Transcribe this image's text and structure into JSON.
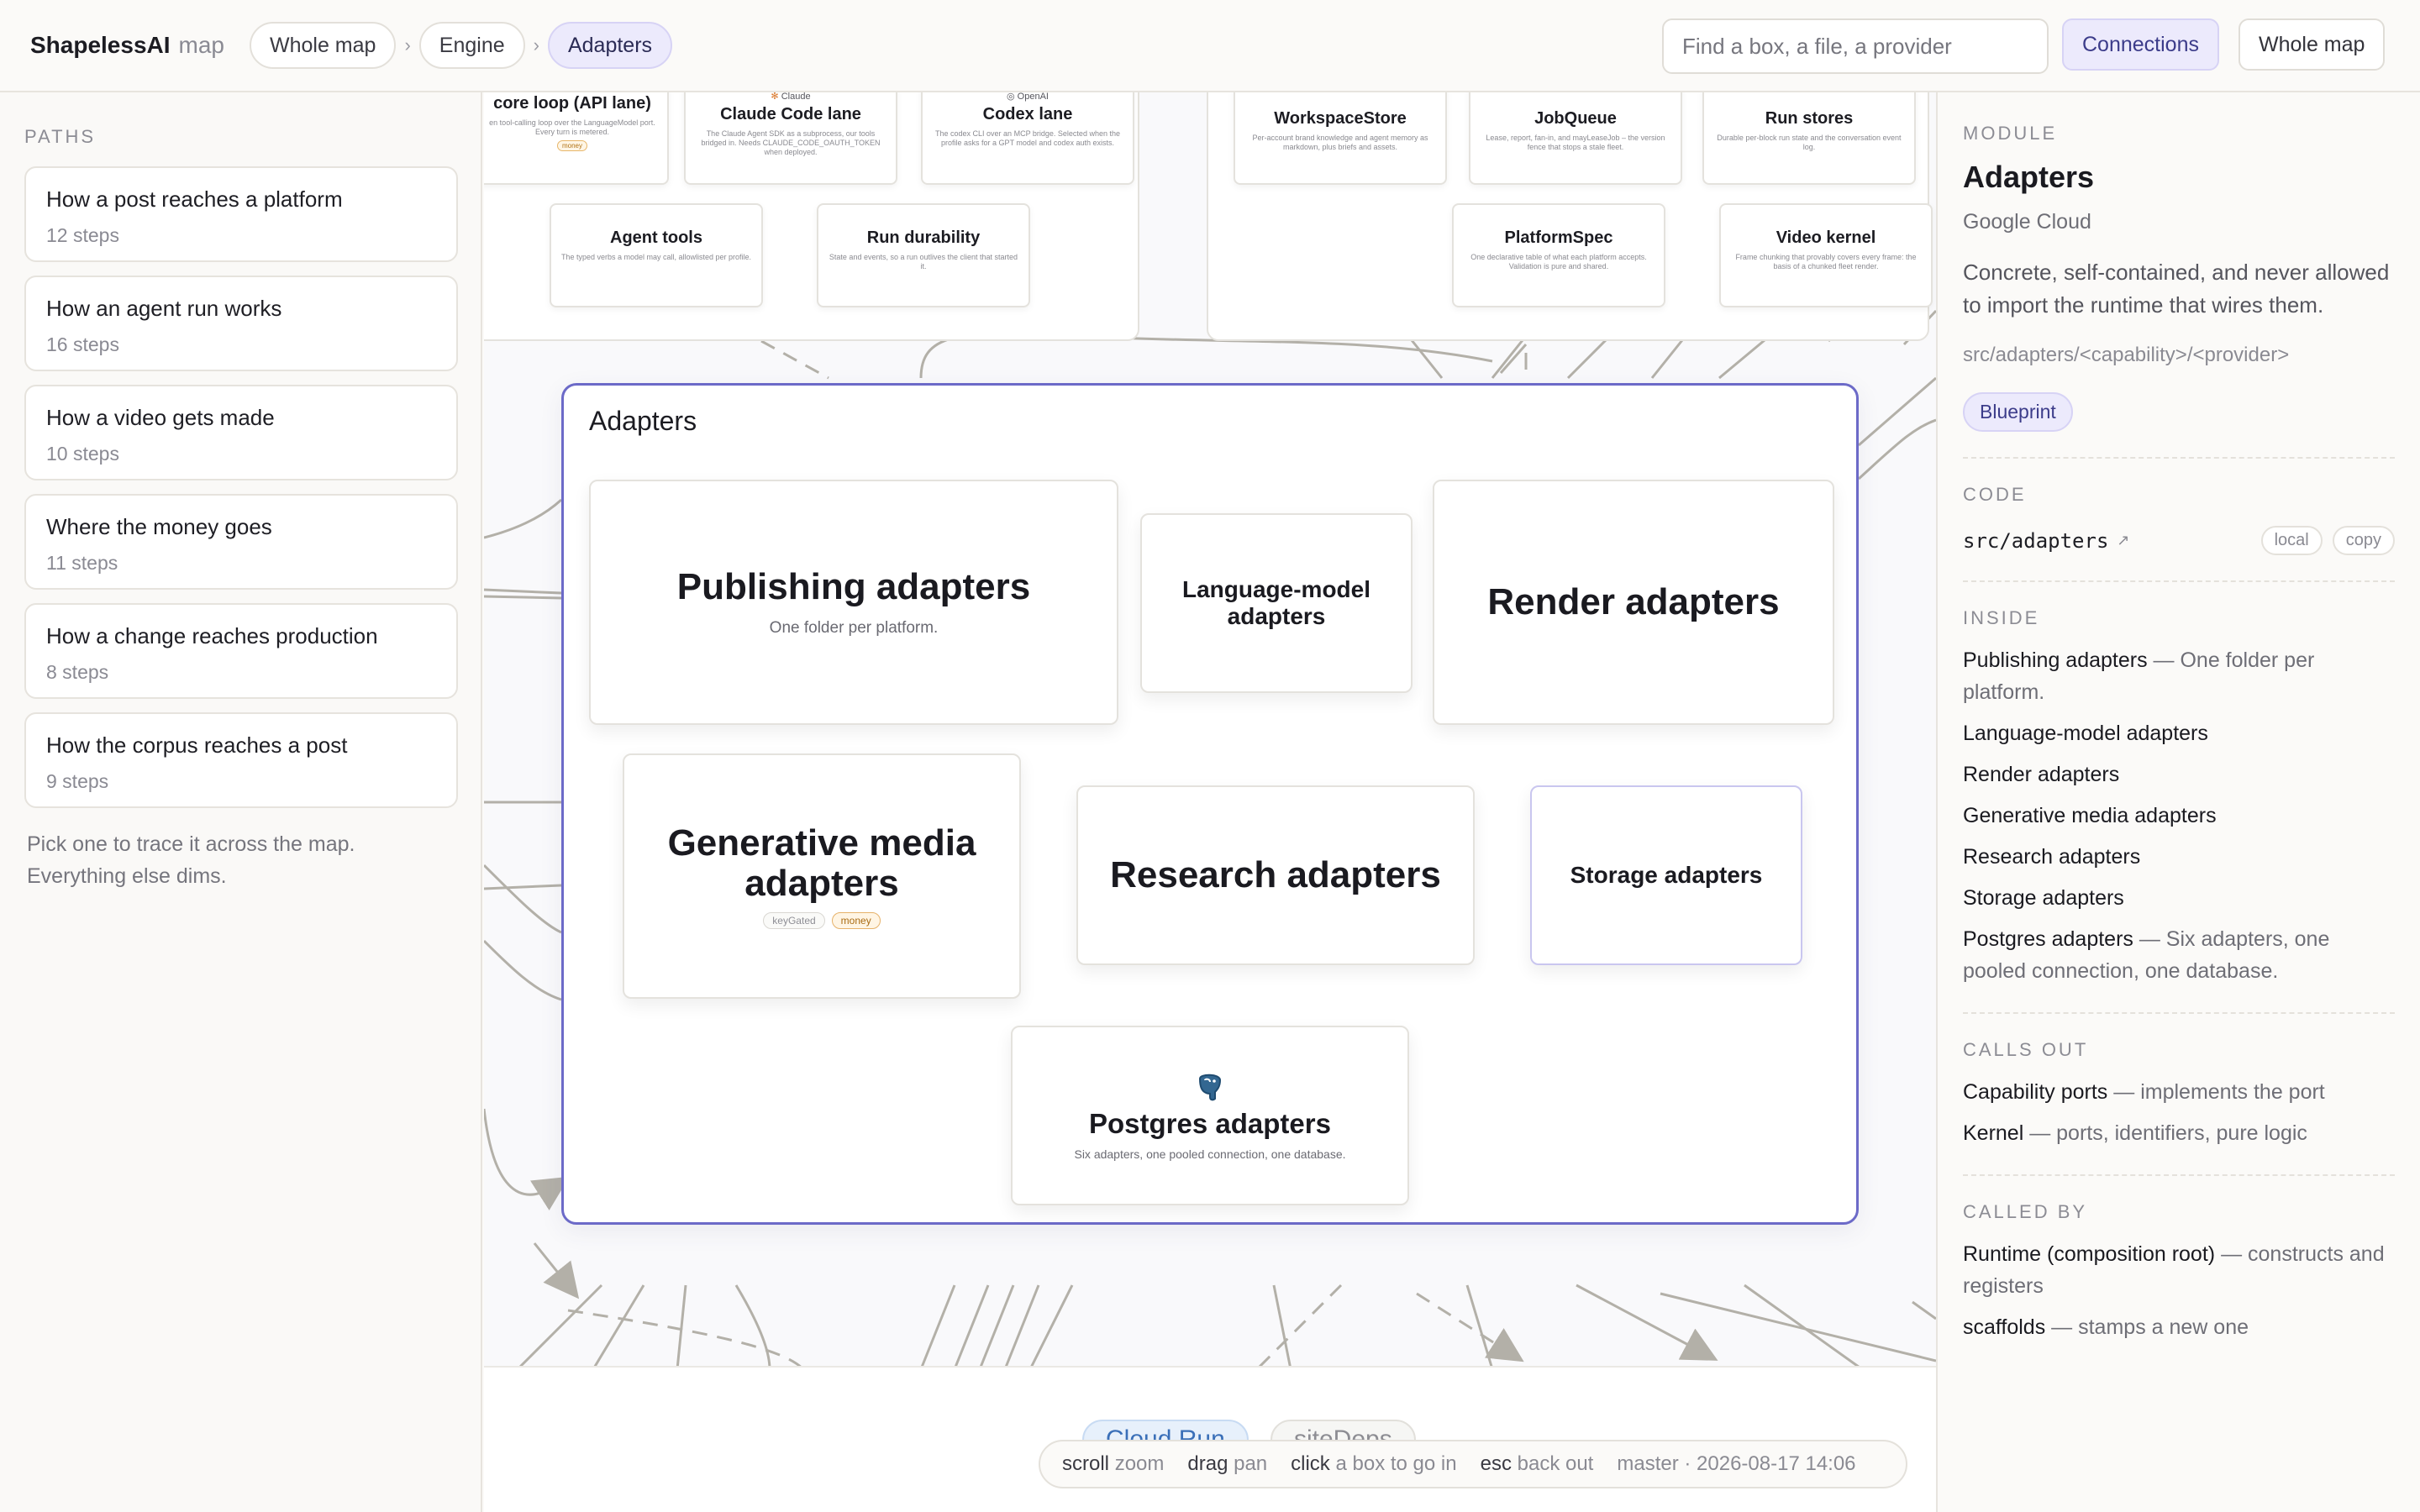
{
  "brand": {
    "name": "ShapelessAI",
    "sub": "map"
  },
  "breadcrumbs": [
    "Whole map",
    "Engine",
    "Adapters"
  ],
  "breadcrumb_sep": "›",
  "search": {
    "placeholder": "Find a box, a file, a provider",
    "value": ""
  },
  "top_buttons": {
    "connections": "Connections",
    "whole_map": "Whole map"
  },
  "paths": {
    "heading": "PATHS",
    "items": [
      {
        "title": "How a post reaches a platform",
        "steps": "12 steps"
      },
      {
        "title": "How an agent run works",
        "steps": "16 steps"
      },
      {
        "title": "How a video gets made",
        "steps": "10 steps"
      },
      {
        "title": "Where the money goes",
        "steps": "11 steps"
      },
      {
        "title": "How a change reaches production",
        "steps": "8 steps"
      },
      {
        "title": "How the corpus reaches a post",
        "steps": "9 steps"
      }
    ],
    "hint": "Pick one to trace it across the map. Everything else dims."
  },
  "canvas": {
    "top_cards": [
      {
        "title": "core loop (API lane)",
        "desc": "en tool-calling loop over the LanguageModel port. Every turn is metered.",
        "tag": "money"
      },
      {
        "brand": "Claude",
        "title": "Claude Code lane",
        "desc": "The Claude Agent SDK as a subprocess, our tools bridged in. Needs CLAUDE_CODE_OAUTH_TOKEN when deployed."
      },
      {
        "brand": "OpenAI",
        "title": "Codex lane",
        "desc": "The codex CLI over an MCP bridge. Selected when the profile asks for a GPT model and codex auth exists."
      },
      {
        "title": "Agent tools",
        "desc": "The typed verbs a model may call, allowlisted per profile."
      },
      {
        "title": "Run durability",
        "desc": "State and events, so a run outlives the client that started it."
      },
      {
        "title": "WorkspaceStore",
        "desc": "Per-account brand knowledge and agent memory as markdown, plus briefs and assets."
      },
      {
        "title": "JobQueue",
        "desc": "Lease, report, fan-in, and mayLeaseJob – the version fence that stops a stale fleet."
      },
      {
        "title": "Run stores",
        "desc": "Durable per-block run state and the conversation event log."
      },
      {
        "title": "PlatformSpec",
        "desc": "One declarative table of what each platform accepts. Validation is pure and shared."
      },
      {
        "title": "Video kernel",
        "desc": "Frame chunking that provably covers every frame: the basis of a chunked fleet render."
      }
    ],
    "adapters_group": {
      "title": "Adapters",
      "cards": [
        {
          "title": "Publishing adapters",
          "desc": "One folder per platform."
        },
        {
          "title": "Language-model adapters"
        },
        {
          "title": "Render adapters"
        },
        {
          "title": "Generative media adapters",
          "tags": [
            "keyGated",
            "money"
          ]
        },
        {
          "title": "Research adapters"
        },
        {
          "title": "Storage adapters"
        },
        {
          "title": "Postgres adapters",
          "desc": "Six adapters, one pooled connection, one database.",
          "icon": "postgres-elephant-icon"
        }
      ]
    },
    "lower_pills": [
      "Cloud Run",
      "siteDeps"
    ],
    "status": {
      "keys": [
        {
          "key": "scroll",
          "action": "zoom"
        },
        {
          "key": "drag",
          "action": "pan"
        },
        {
          "key": "click",
          "action": "a box to go in"
        },
        {
          "key": "esc",
          "action": "back out"
        }
      ],
      "build": "master · 2026-08-17 14:06"
    }
  },
  "detail": {
    "kind": "MODULE",
    "title": "Adapters",
    "provider": "Google Cloud",
    "description": "Concrete, self-contained, and never allowed to import the runtime that wires them.",
    "path_pattern": "src/adapters/<capability>/<provider>",
    "badge": "Blueprint",
    "code": {
      "heading": "CODE",
      "path": "src/adapters",
      "ext": "↗",
      "local": "local",
      "copy": "copy"
    },
    "inside": {
      "heading": "INSIDE",
      "items": [
        {
          "name": "Publishing adapters",
          "note": " — One folder per platform."
        },
        {
          "name": "Language-model adapters",
          "note": ""
        },
        {
          "name": "Render adapters",
          "note": ""
        },
        {
          "name": "Generative media adapters",
          "note": ""
        },
        {
          "name": "Research adapters",
          "note": ""
        },
        {
          "name": "Storage adapters",
          "note": ""
        },
        {
          "name": "Postgres adapters",
          "note": " — Six adapters, one pooled connection, one database."
        }
      ]
    },
    "calls_out": {
      "heading": "CALLS OUT",
      "items": [
        {
          "name": "Capability ports",
          "note": " — implements the port"
        },
        {
          "name": "Kernel",
          "note": " — ports, identifiers, pure logic"
        }
      ]
    },
    "called_by": {
      "heading": "CALLED BY",
      "items": [
        {
          "name": "Runtime (composition root)",
          "note": " — constructs and registers"
        },
        {
          "name": "scaffolds",
          "note": " — stamps a new one"
        }
      ]
    }
  },
  "colors": {
    "accent": "#6c6ac8",
    "accent_soft": "#eceafc",
    "edge": "#b3b0a8",
    "money": "#e6b26a"
  }
}
